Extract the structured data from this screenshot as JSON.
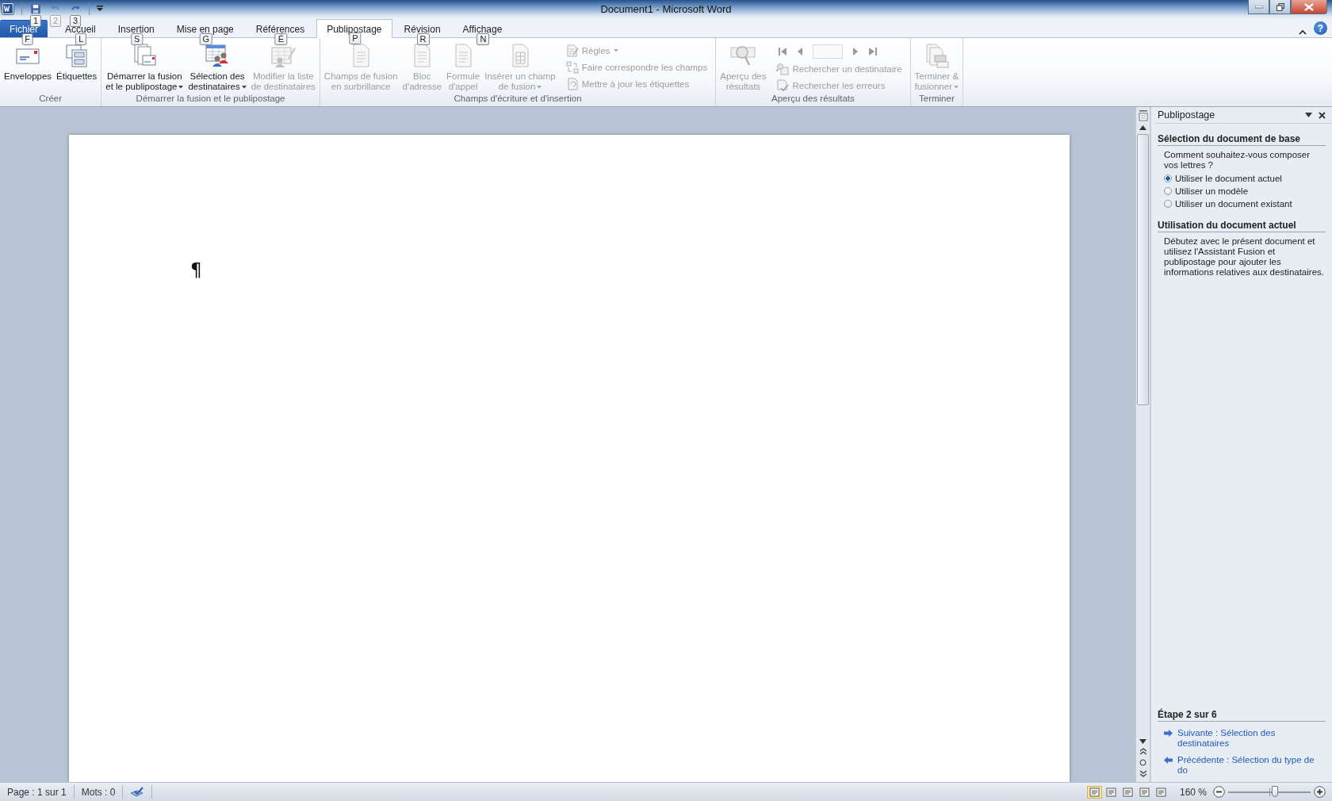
{
  "window": {
    "title": "Document1  -  Microsoft Word"
  },
  "quick_access": [
    {
      "kind": "save",
      "keytip": "1",
      "disabled": false
    },
    {
      "kind": "undo",
      "keytip": "2",
      "disabled": true
    },
    {
      "kind": "redo",
      "keytip": "3",
      "disabled": false
    }
  ],
  "tabs": [
    {
      "label": "Fichier",
      "keytip": "F",
      "kind": "file",
      "selected": false
    },
    {
      "label": "Accueil",
      "keytip": "L",
      "kind": "tab",
      "selected": false
    },
    {
      "label": "Insertion",
      "keytip": "S",
      "kind": "tab",
      "selected": false
    },
    {
      "label": "Mise en page",
      "keytip": "G",
      "kind": "tab",
      "selected": false
    },
    {
      "label": "Références",
      "keytip": "É",
      "kind": "tab",
      "selected": false
    },
    {
      "label": "Publipostage",
      "keytip": "P",
      "kind": "tab",
      "selected": true
    },
    {
      "label": "Révision",
      "keytip": "R",
      "kind": "tab",
      "selected": false
    },
    {
      "label": "Affichage",
      "keytip": "N",
      "kind": "tab",
      "selected": false
    }
  ],
  "help_button": {
    "label": "?"
  },
  "ribbon": {
    "groups": [
      {
        "label": "Créer",
        "items": [
          {
            "kind": "large",
            "lines": [
              "Enveloppes"
            ],
            "disabled": false,
            "dropdown": false
          },
          {
            "kind": "large",
            "lines": [
              "Étiquettes"
            ],
            "disabled": false,
            "dropdown": false
          }
        ]
      },
      {
        "label": "Démarrer la fusion et le publipostage",
        "items": [
          {
            "kind": "large",
            "lines": [
              "Démarrer la fusion",
              "et le publipostage"
            ],
            "disabled": false,
            "dropdown": true
          },
          {
            "kind": "large",
            "lines": [
              "Sélection des",
              "destinataires"
            ],
            "disabled": false,
            "dropdown": true
          },
          {
            "kind": "large",
            "lines": [
              "Modifier la liste",
              "de destinataires"
            ],
            "disabled": true,
            "dropdown": false
          }
        ]
      },
      {
        "label": "Champs d'écriture et d'insertion",
        "items": [
          {
            "kind": "large",
            "lines": [
              "Champs de fusion",
              "en surbrillance"
            ],
            "disabled": true,
            "dropdown": false
          },
          {
            "kind": "large",
            "lines": [
              "Bloc",
              "d'adresse"
            ],
            "disabled": true,
            "dropdown": false
          },
          {
            "kind": "large",
            "lines": [
              "Formule",
              "d'appel"
            ],
            "disabled": true,
            "dropdown": false
          },
          {
            "kind": "large",
            "lines": [
              "Insérer un champ",
              "de fusion"
            ],
            "disabled": true,
            "dropdown": true
          },
          {
            "kind": "small",
            "lines": [
              "Règles"
            ],
            "disabled": true,
            "dropdown": true
          },
          {
            "kind": "small",
            "lines": [
              "Faire correspondre les champs"
            ],
            "disabled": true,
            "dropdown": false
          },
          {
            "kind": "small",
            "lines": [
              "Mettre à jour les étiquettes"
            ],
            "disabled": true,
            "dropdown": false
          }
        ]
      },
      {
        "label": "Aperçu des résultats",
        "items": [
          {
            "kind": "large",
            "lines": [
              "Aperçu des",
              "résultats"
            ],
            "disabled": true,
            "dropdown": false
          },
          {
            "kind": "nav",
            "disabled": true
          },
          {
            "kind": "small",
            "lines": [
              "Rechercher un destinataire"
            ],
            "disabled": true,
            "dropdown": false
          },
          {
            "kind": "small",
            "lines": [
              "Rechercher les erreurs"
            ],
            "disabled": true,
            "dropdown": false
          }
        ]
      },
      {
        "label": "Terminer",
        "items": [
          {
            "kind": "large",
            "lines": [
              "Terminer &",
              "fusionner"
            ],
            "disabled": true,
            "dropdown": true
          }
        ]
      }
    ]
  },
  "document": {
    "paragraph_mark": "¶"
  },
  "task_pane": {
    "title": "Publipostage",
    "sections": [
      {
        "heading": "Sélection du document de base",
        "text": "Comment souhaitez-vous composer vos lettres ?",
        "options": [
          {
            "label": "Utiliser le document actuel",
            "selected": true
          },
          {
            "label": "Utiliser un modèle",
            "selected": false
          },
          {
            "label": "Utiliser un document existant",
            "selected": false
          }
        ]
      },
      {
        "heading": "Utilisation du document actuel",
        "text": "Débutez avec le présent document et utilisez l'Assistant Fusion et publipostage pour ajouter les informations relatives aux destinataires."
      }
    ],
    "step": "Étape 2 sur 6",
    "links": [
      {
        "kind": "next",
        "label": "Suivante : Sélection des destinataires"
      },
      {
        "kind": "previous",
        "label": "Précédente : Sélection du type de do"
      }
    ]
  },
  "status_bar": {
    "page": "Page : 1 sur 1",
    "words": "Mots : 0",
    "views": [
      {
        "selected": true
      },
      {
        "selected": false
      },
      {
        "selected": false
      },
      {
        "selected": false
      },
      {
        "selected": false
      }
    ],
    "zoom": "160 %",
    "zoom_slider": {
      "level": 0.57
    }
  }
}
